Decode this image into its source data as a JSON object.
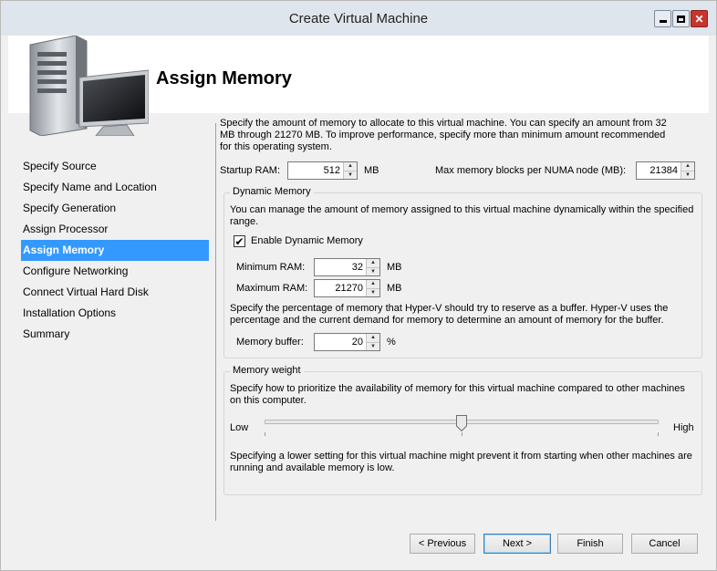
{
  "window": {
    "title": "Create Virtual Machine"
  },
  "header": {
    "page_title": "Assign Memory"
  },
  "nav": {
    "items": [
      {
        "label": "Specify Source",
        "active": false
      },
      {
        "label": "Specify Name and Location",
        "active": false
      },
      {
        "label": "Specify Generation",
        "active": false
      },
      {
        "label": "Assign Processor",
        "active": false
      },
      {
        "label": "Assign Memory",
        "active": true
      },
      {
        "label": "Configure Networking",
        "active": false
      },
      {
        "label": "Connect Virtual Hard Disk",
        "active": false
      },
      {
        "label": "Installation Options",
        "active": false
      },
      {
        "label": "Summary",
        "active": false
      }
    ]
  },
  "intro": {
    "text": "Specify the amount of memory to allocate to this virtual machine. You can specify an amount from 32 MB through 21270 MB. To improve performance, specify more than minimum amount recommended for this operating system."
  },
  "startup_ram": {
    "label": "Startup RAM:",
    "value": "512",
    "unit": "MB"
  },
  "numa": {
    "label": "Max memory blocks per NUMA node (MB):",
    "value": "21384"
  },
  "dynamic_memory": {
    "group_title": "Dynamic Memory",
    "description": "You can manage the amount of memory assigned to this virtual machine dynamically within the specified range.",
    "enable_label": "Enable Dynamic Memory",
    "enabled": true,
    "min_label": "Minimum RAM:",
    "min_value": "32",
    "min_unit": "MB",
    "max_label": "Maximum RAM:",
    "max_value": "21270",
    "max_unit": "MB",
    "buffer_description": "Specify the percentage of memory that Hyper-V should try to reserve as a buffer. Hyper-V uses the percentage and the current demand for memory to determine an amount of memory for the buffer.",
    "buffer_label": "Memory buffer:",
    "buffer_value": "20",
    "buffer_unit": "%"
  },
  "memory_weight": {
    "group_title": "Memory weight",
    "description": "Specify how to prioritize the availability of memory for this virtual machine compared to other machines on this computer.",
    "low_label": "Low",
    "high_label": "High",
    "slider_fraction": 0.5,
    "warning": "Specifying a lower setting for this virtual machine might prevent it from starting when other machines are running and available memory is low."
  },
  "buttons": {
    "previous": "< Previous",
    "next": "Next >",
    "finish": "Finish",
    "cancel": "Cancel"
  },
  "colors": {
    "selection": "#3399ff",
    "title_bar": "#dfe5ec",
    "close_button": "#c7362e"
  },
  "icons": {
    "check": "✔",
    "spin_up": "▲",
    "spin_down": "▼"
  }
}
